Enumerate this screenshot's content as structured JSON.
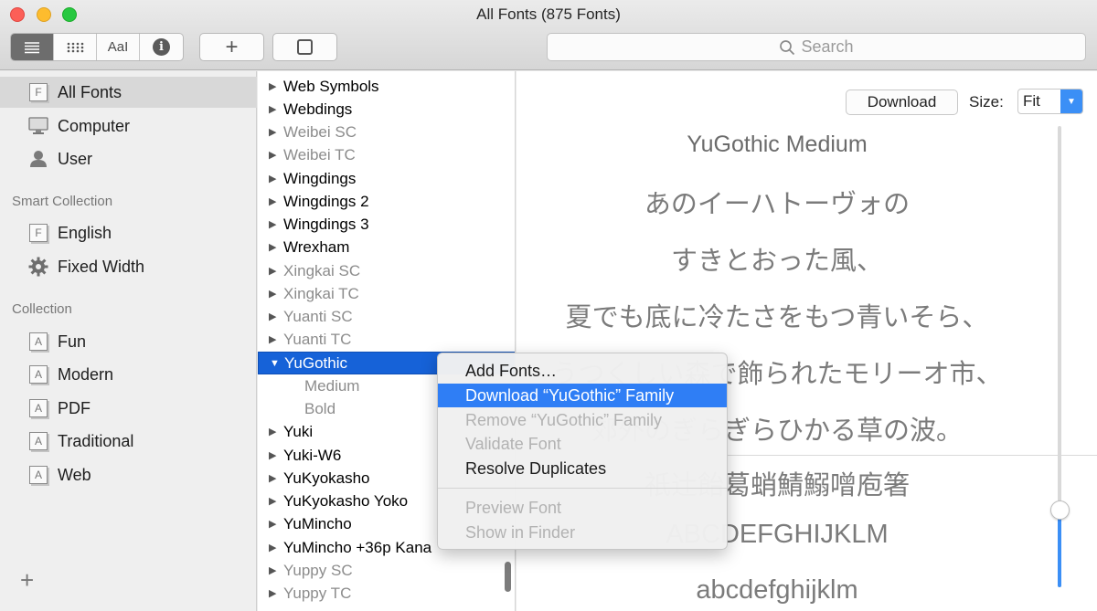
{
  "window": {
    "title": "All Fonts (875 Fonts)"
  },
  "toolbar": {
    "sample_label": "AaI",
    "info_label": "i",
    "add_label": "+",
    "search_placeholder": "Search"
  },
  "sidebar": {
    "library_items": [
      {
        "label": "All Fonts",
        "icon": "font-collection-icon",
        "selected": true
      },
      {
        "label": "Computer",
        "icon": "computer-icon"
      },
      {
        "label": "User",
        "icon": "user-icon"
      }
    ],
    "smart_collection_header": "Smart Collection",
    "smart_items": [
      {
        "label": "English",
        "icon": "font-collection-icon"
      },
      {
        "label": "Fixed Width",
        "icon": "gear-icon"
      }
    ],
    "collection_header": "Collection",
    "collection_items": [
      {
        "label": "Fun"
      },
      {
        "label": "Modern"
      },
      {
        "label": "PDF"
      },
      {
        "label": "Traditional"
      },
      {
        "label": "Web"
      }
    ],
    "add_label": "+"
  },
  "font_list": [
    {
      "label": "Web Symbols",
      "type": "family"
    },
    {
      "label": "Webdings",
      "type": "family"
    },
    {
      "label": "Weibei SC",
      "type": "family",
      "dim": true
    },
    {
      "label": "Weibei TC",
      "type": "family",
      "dim": true
    },
    {
      "label": "Wingdings",
      "type": "family"
    },
    {
      "label": "Wingdings 2",
      "type": "family"
    },
    {
      "label": "Wingdings 3",
      "type": "family"
    },
    {
      "label": "Wrexham",
      "type": "family"
    },
    {
      "label": "Xingkai SC",
      "type": "family",
      "dim": true
    },
    {
      "label": "Xingkai TC",
      "type": "family",
      "dim": true
    },
    {
      "label": "Yuanti SC",
      "type": "family",
      "dim": true
    },
    {
      "label": "Yuanti TC",
      "type": "family",
      "dim": true
    },
    {
      "label": "YuGothic",
      "type": "family",
      "expanded": true,
      "selected": true
    },
    {
      "label": "Medium",
      "type": "style"
    },
    {
      "label": "Bold",
      "type": "style"
    },
    {
      "label": "Yuki",
      "type": "family"
    },
    {
      "label": "Yuki-W6",
      "type": "family"
    },
    {
      "label": "YuKyokasho",
      "type": "family"
    },
    {
      "label": "YuKyokasho Yoko",
      "type": "family"
    },
    {
      "label": "YuMincho",
      "type": "family"
    },
    {
      "label": "YuMincho +36p Kana",
      "type": "family"
    },
    {
      "label": "Yuppy SC",
      "type": "family",
      "dim": true
    },
    {
      "label": "Yuppy TC",
      "type": "family",
      "dim": true
    }
  ],
  "preview": {
    "download_label": "Download",
    "size_label": "Size:",
    "size_value": "Fit",
    "font_name": "YuGothic Medium",
    "lines": [
      "あのイーハトーヴォの",
      "すきとおった風、",
      "夏でも底に冷たさをもつ青いそら、",
      "うつくしい森で飾られたモリーオ市、",
      "郊外のぎらぎらひかる草の波。"
    ],
    "glyph_lines": [
      "祇辻飴葛蛸鯖鰯噌庖箸",
      "ABCDEFGHIJKLM",
      "abcdefghijklm"
    ]
  },
  "context_menu": {
    "items": [
      {
        "label": "Add Fonts…",
        "state": "normal"
      },
      {
        "label": "Download “YuGothic” Family",
        "state": "highlight"
      },
      {
        "label": "Remove “YuGothic” Family",
        "state": "disabled"
      },
      {
        "label": "Validate Font",
        "state": "disabled"
      },
      {
        "label": "Resolve Duplicates",
        "state": "normal"
      },
      {
        "separator": true
      },
      {
        "label": "Preview Font",
        "state": "disabled"
      },
      {
        "label": "Show in Finder",
        "state": "disabled"
      }
    ]
  },
  "colors": {
    "selection_blue": "#1662d8",
    "menu_highlight": "#2f7ef5",
    "slider_blue": "#3b8ff6"
  }
}
